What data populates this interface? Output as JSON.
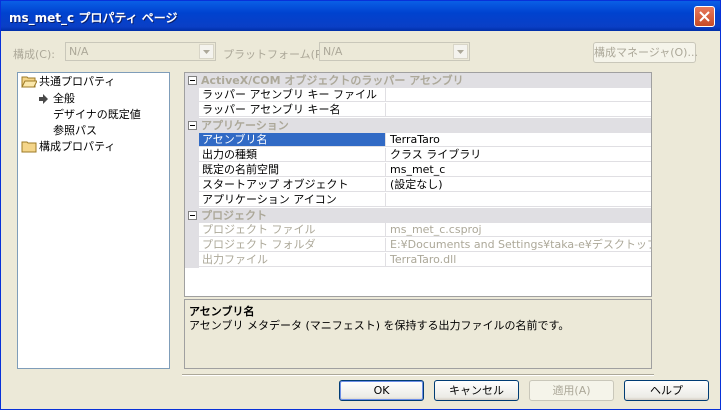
{
  "window": {
    "title": "ms_met_c プロパティ ページ"
  },
  "toolbar": {
    "config_label": "構成(C):",
    "config_value": "N/A",
    "platform_label": "プラットフォーム(P):",
    "platform_value": "N/A",
    "config_manager_label": "構成マネージャ(O)..."
  },
  "tree": {
    "common_props": "共通プロパティ",
    "general": "全般",
    "designer_defaults": "デザイナの既定値",
    "reference_path": "参照パス",
    "config_props": "構成プロパティ"
  },
  "grid": {
    "cat_wrapper": "ActiveX/COM オブジェクトのラッパー アセンブリ",
    "wrapper_key_file": "ラッパー アセンブリ キー ファイル",
    "wrapper_key_name": "ラッパー アセンブリ キー名",
    "cat_application": "アプリケーション",
    "assembly_name": {
      "name": "アセンブリ名",
      "value": "TerraTaro"
    },
    "output_type": {
      "name": "出力の種類",
      "value": "クラス ライブラリ"
    },
    "default_namespace": {
      "name": "既定の名前空間",
      "value": "ms_met_c"
    },
    "startup_object": {
      "name": "スタートアップ オブジェクト",
      "value": "(設定なし)"
    },
    "app_icon": {
      "name": "アプリケーション アイコン",
      "value": ""
    },
    "cat_project": "プロジェクト",
    "project_file": {
      "name": "プロジェクト ファイル",
      "value": "ms_met_c.csproj"
    },
    "project_folder": {
      "name": "プロジェクト フォルダ",
      "value": "E:¥Documents and Settings¥taka-e¥デスクトップ¥ms_"
    },
    "output_file": {
      "name": "出力ファイル",
      "value": "TerraTaro.dll"
    }
  },
  "description": {
    "title": "アセンブリ名",
    "text": "アセンブリ メタデータ (マニフェスト) を保持する出力ファイルの名前です。"
  },
  "buttons": {
    "ok": "OK",
    "cancel": "キャンセル",
    "apply": "適用(A)",
    "help": "ヘルプ"
  },
  "colors": {
    "titlebar": "#0a3fc6",
    "selection": "#316ac5",
    "dialog_bg": "#ece9d8"
  },
  "icons": [
    "close-icon",
    "folder-icon",
    "arrow-right-icon",
    "dropdown-arrow-icon",
    "collapse-icon"
  ]
}
